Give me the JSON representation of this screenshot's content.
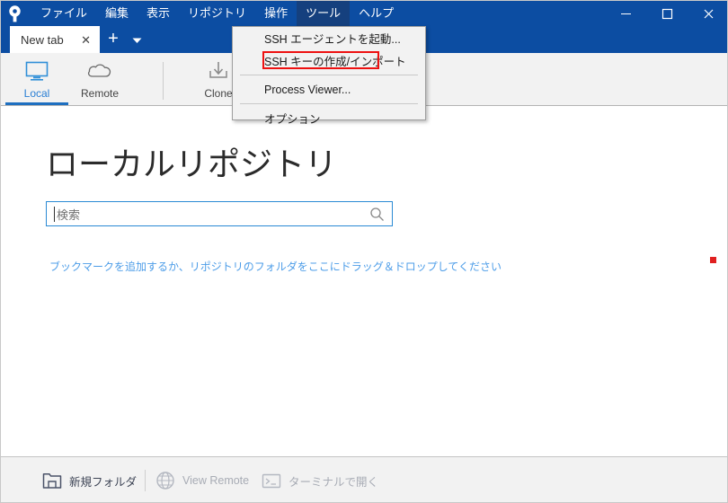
{
  "window": {
    "logo_icon": "sourcetree-logo-icon",
    "controls": {
      "minimize": "—",
      "maximize": "□",
      "close": "✕"
    }
  },
  "menubar": {
    "items": [
      {
        "label": "ファイル",
        "active": false
      },
      {
        "label": "編集",
        "active": false
      },
      {
        "label": "表示",
        "active": false
      },
      {
        "label": "リポジトリ",
        "active": false
      },
      {
        "label": "操作",
        "active": false
      },
      {
        "label": "ツール",
        "active": true
      },
      {
        "label": "ヘルプ",
        "active": false
      }
    ]
  },
  "tabstrip": {
    "tab_label": "New tab",
    "close_glyph": "✕",
    "add_glyph": "+",
    "menu_icon": "chevron-down-icon"
  },
  "toolbar": {
    "items": [
      {
        "label": "Local",
        "icon": "monitor-icon",
        "selected": true
      },
      {
        "label": "Remote",
        "icon": "cloud-icon",
        "selected": false
      },
      {
        "label": "Clone",
        "icon": "clone-download-icon",
        "selected": false
      }
    ]
  },
  "main": {
    "title": "ローカルリポジトリ",
    "search": {
      "placeholder": "検索",
      "icon": "search-icon"
    },
    "hint_link": "ブックマークを追加するか、リポジトリのフォルダをここにドラッグ＆ドロップしてください",
    "marker_color": "#e02020"
  },
  "bottombar": {
    "items": [
      {
        "label": "新規フォルダ",
        "icon": "new-folder-icon",
        "disabled": false
      },
      {
        "label": "View Remote",
        "icon": "globe-icon",
        "disabled": true
      },
      {
        "label": "ターミナルで開く",
        "icon": "terminal-icon",
        "disabled": true
      }
    ]
  },
  "dropdown": {
    "items": [
      {
        "label": "SSH エージェントを起動..."
      },
      {
        "label": "SSH キーの作成/インポート"
      },
      {
        "label": "Process Viewer..."
      },
      {
        "label": "オプション"
      }
    ],
    "highlight_color": "#ee1111"
  },
  "colors": {
    "titlebar_blue": "#0C4DA2",
    "accent_blue": "#2a7fd4",
    "link_blue": "#4d9de8"
  }
}
